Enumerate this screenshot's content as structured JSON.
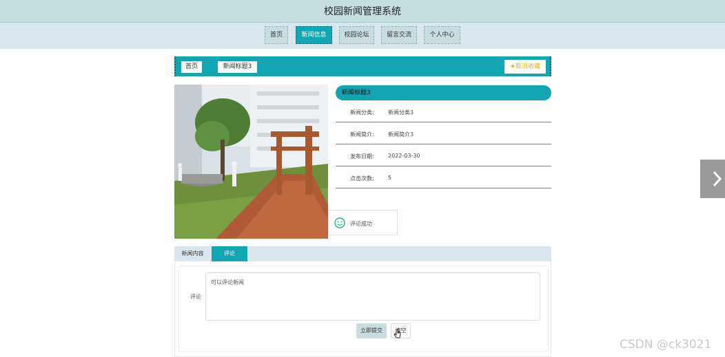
{
  "header": {
    "title": "校园新闻管理系统"
  },
  "nav": [
    {
      "label": "首页"
    },
    {
      "label": "新闻信息"
    },
    {
      "label": "校园论坛"
    },
    {
      "label": "留言交流"
    },
    {
      "label": "个人中心"
    }
  ],
  "breadcrumb": {
    "home": "首页",
    "current": "新闻标题3",
    "favorite_label": "取消收藏"
  },
  "detail": {
    "title": "新闻标题3",
    "fields": [
      {
        "key": "新闻分类:",
        "value": "新闻分类3"
      },
      {
        "key": "新闻简介:",
        "value": "新闻简介3"
      },
      {
        "key": "发布日期:",
        "value": "2022-03-30"
      },
      {
        "key": "点击次数:",
        "value": "5"
      }
    ]
  },
  "toast": {
    "message": "评论成功"
  },
  "tabs": [
    {
      "label": "新闻内容"
    },
    {
      "label": "评论"
    }
  ],
  "comment": {
    "label": "评论",
    "text": "可以评论新闻",
    "submit_label": "立即提交",
    "reset_label": "清空"
  },
  "watermark": "CSDN @ck3021",
  "colors": {
    "accent": "#12a5b2",
    "header_bg": "#c5dfe1",
    "nav_bg": "#d9e6ee",
    "favorite": "#e8b300"
  }
}
